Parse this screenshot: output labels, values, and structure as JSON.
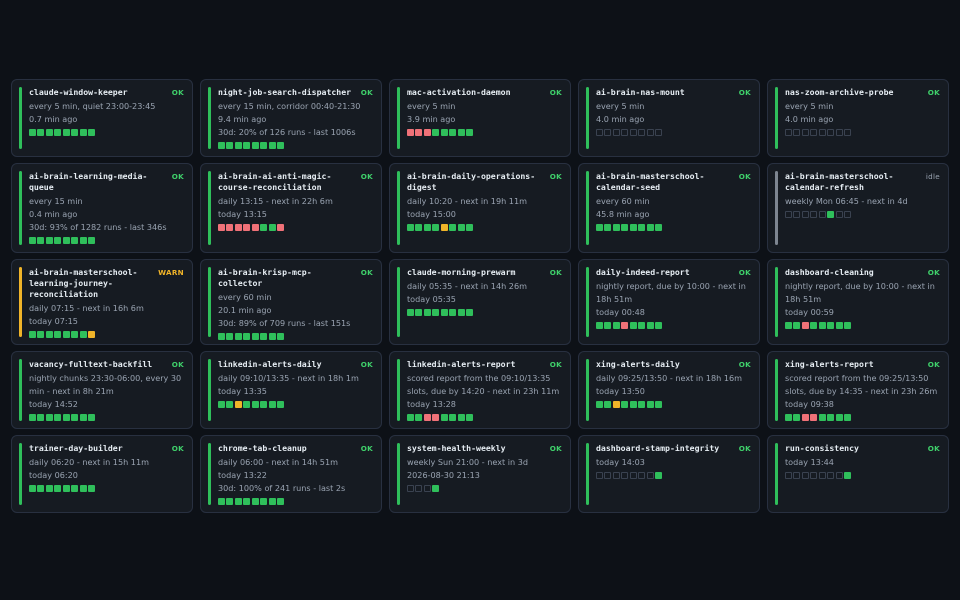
{
  "colors": {
    "background": "#0d1117",
    "card": "#161b22",
    "ok": "#2fbf5b",
    "fail": "#f07178",
    "warn": "#f0b429",
    "idle": "#7d8590"
  },
  "legend": {
    "g": "ok",
    "r": "fail",
    "y": "warn",
    "e": "no-run"
  },
  "jobs": [
    {
      "name": "claude-window-keeper",
      "status": "OK",
      "lines": [
        "every 5 min, quiet 23:00-23:45",
        "0.7 min ago"
      ],
      "runs": "gggggggg"
    },
    {
      "name": "night-job-search-dispatcher",
      "status": "OK",
      "lines": [
        "every 15 min, corridor 00:40-21:30",
        "9.4 min ago",
        "30d: 20% of 126 runs - last 1006s"
      ],
      "runs": "gggggggg"
    },
    {
      "name": "mac-activation-daemon",
      "status": "OK",
      "lines": [
        "every 5 min",
        "3.9 min ago"
      ],
      "runs": "rrrggggg"
    },
    {
      "name": "ai-brain-nas-mount",
      "status": "OK",
      "lines": [
        "every 5 min",
        "4.0 min ago"
      ],
      "runs": "eeeeeeee"
    },
    {
      "name": "nas-zoom-archive-probe",
      "status": "OK",
      "lines": [
        "every 5 min",
        "4.0 min ago"
      ],
      "runs": "eeeeeeee"
    },
    {
      "name": "ai-brain-learning-media-queue",
      "status": "OK",
      "lines": [
        "every 15 min",
        "0.4 min ago",
        "30d: 93% of 1282 runs - last 346s"
      ],
      "runs": "gggggggg"
    },
    {
      "name": "ai-brain-ai-anti-magic-course-reconciliation",
      "status": "OK",
      "lines": [
        "daily 13:15 - next in 22h 6m",
        "today 13:15"
      ],
      "runs": "rrrrrggr"
    },
    {
      "name": "ai-brain-daily-operations-digest",
      "status": "OK",
      "lines": [
        "daily 10:20 - next in 19h 11m",
        "today 15:00"
      ],
      "runs": "ggggyggg"
    },
    {
      "name": "ai-brain-masterschool-calendar-seed",
      "status": "OK",
      "lines": [
        "every 60 min",
        "45.8 min ago"
      ],
      "runs": "gggggggg"
    },
    {
      "name": "ai-brain-masterschool-calendar-refresh",
      "status": "idle",
      "lines": [
        "weekly Mon 06:45 - next in 4d"
      ],
      "runs": "eeeeegee"
    },
    {
      "name": "ai-brain-masterschool-learning-journey-reconciliation",
      "status": "WARN",
      "lines": [
        "daily 07:15 - next in 16h 6m",
        "today 07:15"
      ],
      "runs": "gggggggy"
    },
    {
      "name": "ai-brain-krisp-mcp-collector",
      "status": "OK",
      "lines": [
        "every 60 min",
        "20.1 min ago",
        "30d: 89% of 709 runs - last 151s"
      ],
      "runs": "gggggggg"
    },
    {
      "name": "claude-morning-prewarm",
      "status": "OK",
      "lines": [
        "daily 05:35 - next in 14h 26m",
        "today 05:35"
      ],
      "runs": "gggggggg"
    },
    {
      "name": "daily-indeed-report",
      "status": "OK",
      "lines": [
        "nightly report, due by 10:00 - next in 18h 51m",
        "today 00:48"
      ],
      "runs": "gggrgggg"
    },
    {
      "name": "dashboard-cleaning",
      "status": "OK",
      "lines": [
        "nightly report, due by 10:00 - next in 18h 51m",
        "today 00:59"
      ],
      "runs": "ggrggggg"
    },
    {
      "name": "vacancy-fulltext-backfill",
      "status": "OK",
      "lines": [
        "nightly chunks 23:30-06:00, every 30 min - next in 8h 21m",
        "today 14:52"
      ],
      "runs": "gggggggg"
    },
    {
      "name": "linkedin-alerts-daily",
      "status": "OK",
      "lines": [
        "daily 09:10/13:35 - next in 18h 1m",
        "today 13:35"
      ],
      "runs": "ggyggggg"
    },
    {
      "name": "linkedin-alerts-report",
      "status": "OK",
      "lines": [
        "scored report from the 09:10/13:35 slots, due by 14:20 - next in 23h 11m",
        "today 13:28"
      ],
      "runs": "ggrrgggg"
    },
    {
      "name": "xing-alerts-daily",
      "status": "OK",
      "lines": [
        "daily 09:25/13:50 - next in 18h 16m",
        "today 13:50"
      ],
      "runs": "ggyggggg"
    },
    {
      "name": "xing-alerts-report",
      "status": "OK",
      "lines": [
        "scored report from the 09:25/13:50 slots, due by 14:35 - next in 23h 26m",
        "today 09:38"
      ],
      "runs": "ggrrgggg"
    },
    {
      "name": "trainer-day-builder",
      "status": "OK",
      "lines": [
        "daily 06:20 - next in 15h 11m",
        "today 06:20"
      ],
      "runs": "gggggggg"
    },
    {
      "name": "chrome-tab-cleanup",
      "status": "OK",
      "lines": [
        "daily 06:00 - next in 14h 51m",
        "today 13:22",
        "30d: 100% of 241 runs - last 2s"
      ],
      "runs": "gggggggg"
    },
    {
      "name": "system-health-weekly",
      "status": "OK",
      "lines": [
        "weekly Sun 21:00 - next in 3d",
        "2026-08-30 21:13"
      ],
      "runs": "eeeg"
    },
    {
      "name": "dashboard-stamp-integrity",
      "status": "OK",
      "lines": [
        "today 14:03"
      ],
      "runs": "eeeeeeeg"
    },
    {
      "name": "run-consistency",
      "status": "OK",
      "lines": [
        "today 13:44"
      ],
      "runs": "eeeeeeeg"
    }
  ]
}
